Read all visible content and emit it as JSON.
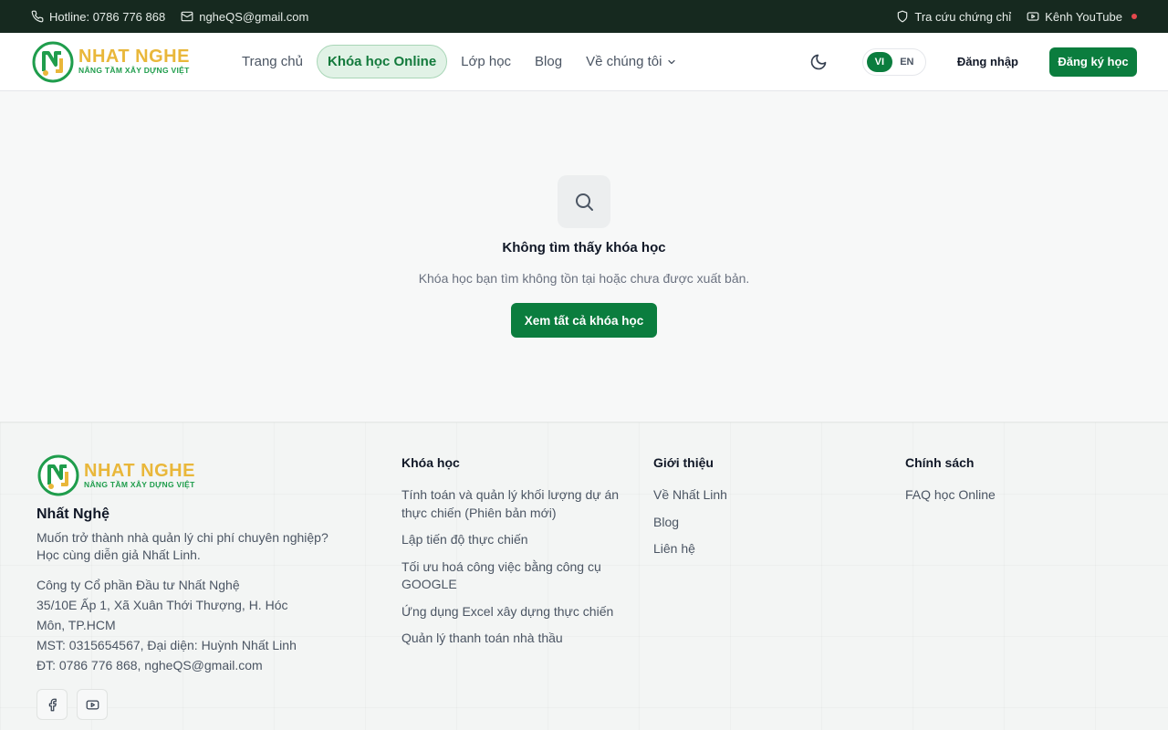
{
  "topbar": {
    "hotline": "Hotline: 0786 776 868",
    "email": "ngheQS@gmail.com",
    "certificate_lookup": "Tra cứu chứng chỉ",
    "youtube": "Kênh YouTube"
  },
  "header": {
    "logo_name": "NHAT NGHE",
    "logo_tagline": "NÂNG TẦM XÂY DỰNG VIỆT",
    "nav": [
      {
        "label": "Trang chủ"
      },
      {
        "label": "Khóa học Online"
      },
      {
        "label": "Lớp học"
      },
      {
        "label": "Blog"
      },
      {
        "label": "Về chúng tôi"
      }
    ],
    "lang_vi": "VI",
    "lang_en": "EN",
    "login": "Đăng nhập",
    "register": "Đăng ký học"
  },
  "main": {
    "title": "Không tìm thấy khóa học",
    "description": "Khóa học bạn tìm không tồn tại hoặc chưa được xuất bản.",
    "button": "Xem tất cả khóa học"
  },
  "footer": {
    "brand_name": "Nhất Nghệ",
    "slogan_line1": "Muốn trở thành nhà quản lý chi phí chuyên nghiệp?",
    "slogan_line2": "Học cùng diễn giả Nhất Linh.",
    "company_line1": "Công ty Cổ phần Đầu tư Nhất Nghệ",
    "company_line2": "35/10E Ấp 1, Xã Xuân Thới Thượng, H. Hóc",
    "company_line3": "Môn, TP.HCM",
    "company_line4": "MST: 0315654567, Đại diện: Huỳnh Nhất Linh",
    "company_line5": "ĐT: 0786 776 868, ngheQS@gmail.com",
    "courses_title": "Khóa học",
    "courses": [
      "Tính toán và quản lý khối lượng dự án thực chiến (Phiên bản mới)",
      "Lập tiến độ thực chiến",
      "Tối ưu hoá công việc bằng công cụ GOOGLE",
      "Ứng dụng Excel xây dựng thực chiến",
      "Quản lý thanh toán nhà thầu"
    ],
    "about_title": "Giới thiệu",
    "about": [
      "Về Nhất Linh",
      "Blog",
      "Liên hệ"
    ],
    "policy_title": "Chính sách",
    "policy": [
      "FAQ học Online"
    ]
  },
  "colors": {
    "brand_green": "#0b7d3e",
    "topbar_bg": "#16291f",
    "logo_gold": "#e9b73a"
  }
}
